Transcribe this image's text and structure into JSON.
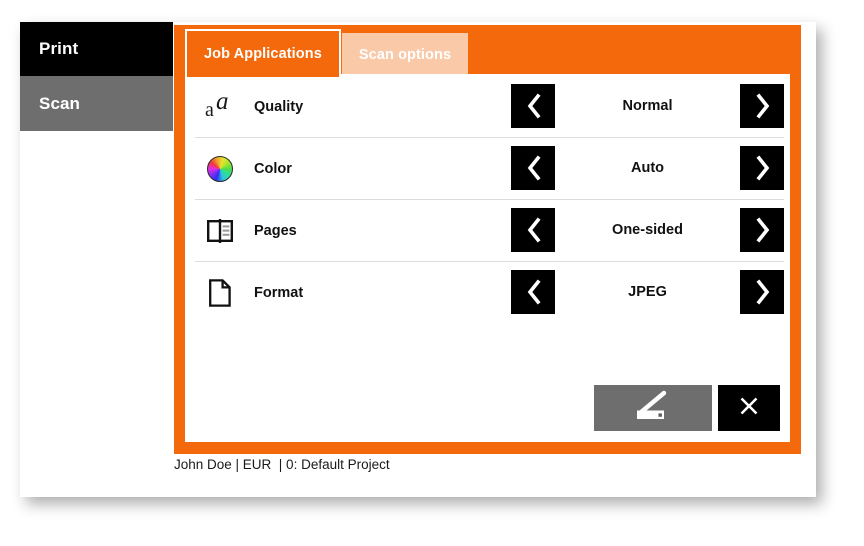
{
  "window": {
    "nav": [
      {
        "id": "print",
        "label": "Print",
        "state": "inactive",
        "bg": "#000000"
      },
      {
        "id": "scan",
        "label": "Scan",
        "state": "selected",
        "bg": "#6e6e6e"
      }
    ],
    "accent_color": "#f4690b",
    "inactive_tab_color": "#fac9a8"
  },
  "dialog": {
    "tabs": [
      {
        "id": "job-applications",
        "label": "Job Applications",
        "active": true
      },
      {
        "id": "scan-options",
        "label": "Scan options",
        "active": false
      }
    ],
    "options": [
      {
        "id": "quality",
        "label": "Quality",
        "icon": "text-quality-icon",
        "value": "Normal",
        "prev_label": "‹",
        "next_label": "›"
      },
      {
        "id": "color",
        "label": "Color",
        "icon": "color-wheel-icon",
        "value": "Auto",
        "prev_label": "‹",
        "next_label": "›"
      },
      {
        "id": "pages",
        "label": "Pages",
        "icon": "open-book-pages-icon",
        "value": "One-sided",
        "prev_label": "‹",
        "next_label": "›"
      },
      {
        "id": "format",
        "label": "Format",
        "icon": "document-format-icon",
        "value": "JPEG",
        "prev_label": "‹",
        "next_label": "›"
      }
    ],
    "actions": {
      "scan_icon": "flatbed-scanner-icon",
      "close_icon": "close-x-icon"
    }
  },
  "status_bar": {
    "text": "John Doe | EUR  | 0: Default Project"
  }
}
